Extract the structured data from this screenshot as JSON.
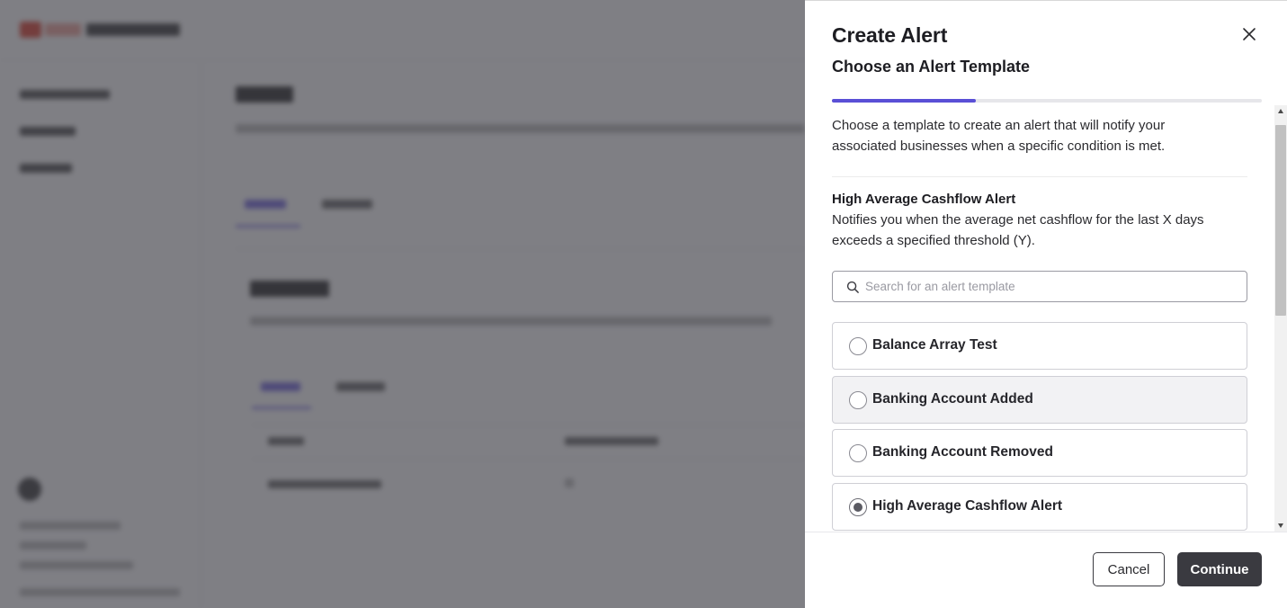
{
  "drawer": {
    "title": "Create Alert",
    "subtitle": "Choose an Alert Template",
    "progress_fraction": 0.335,
    "intro": "Choose a template to create an alert that will notify your associated businesses when a specific condition is met.",
    "selected_template": {
      "name": "High Average Cashflow Alert",
      "description": "Notifies you when the average net cashflow for the last X days exceeds a specified threshold (Y)."
    },
    "search": {
      "placeholder": "Search for an alert template",
      "value": ""
    },
    "templates": [
      {
        "label": "Balance Array Test",
        "checked": false
      },
      {
        "label": "Banking Account Added",
        "checked": false
      },
      {
        "label": "Banking Account Removed",
        "checked": false
      },
      {
        "label": "High Average Cashflow Alert",
        "checked": true
      }
    ],
    "footer": {
      "cancel_label": "Cancel",
      "continue_label": "Continue"
    }
  },
  "colors": {
    "accent": "#5a4fd6",
    "primary_button": "#3a3a40",
    "overlay": "#37373e"
  },
  "icons": {
    "close": "close-icon",
    "search": "search-icon"
  }
}
